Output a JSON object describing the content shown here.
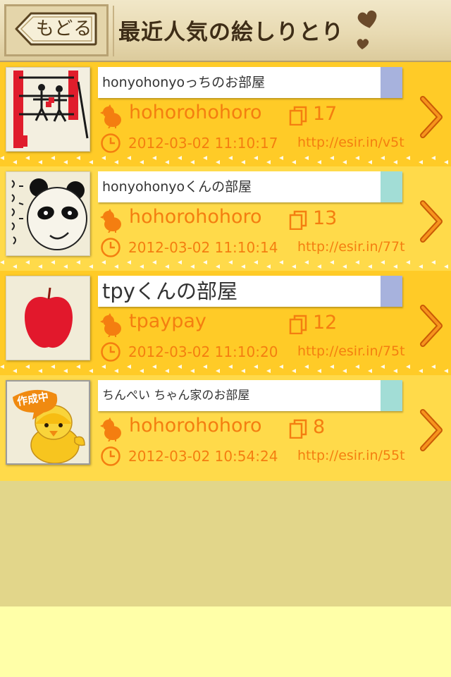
{
  "header": {
    "back_label": "もどる",
    "title": "最近人気の絵しりとり"
  },
  "colors": {
    "row_dark": "#ffcb27",
    "row_light": "#ffda4a",
    "accent_orange": "#f47e10",
    "tag_blue": "#a7b2dd",
    "tag_teal": "#a2ddd6"
  },
  "rooms": [
    {
      "name": "honyohonyoっちのお部屋",
      "user": "hohorohohoro",
      "count": "17",
      "date": "2012-03-02 11:10:17",
      "url": "http://esir.in/v5t",
      "thumb_icon": "boxing-ring-drawing",
      "tag_color": "blue"
    },
    {
      "name": "honyohonyoくんの部屋",
      "user": "hohorohohoro",
      "count": "13",
      "date": "2012-03-02 11:10:14",
      "url": "http://esir.in/77t",
      "thumb_icon": "panda-drawing",
      "tag_color": "teal"
    },
    {
      "name": "tpyくんの部屋",
      "user": "tpaypay",
      "count": "12",
      "date": "2012-03-02 11:10:20",
      "url": "http://esir.in/75t",
      "thumb_icon": "apple-drawing",
      "tag_color": "blue"
    },
    {
      "name": "ちんぺい ちゃん家のお部屋",
      "user": "hohorohohoro",
      "count": "8",
      "date": "2012-03-02 10:54:24",
      "url": "http://esir.in/55t",
      "thumb_icon": "chick-in-progress",
      "thumb_badge": "作成中",
      "tag_color": "teal"
    }
  ]
}
